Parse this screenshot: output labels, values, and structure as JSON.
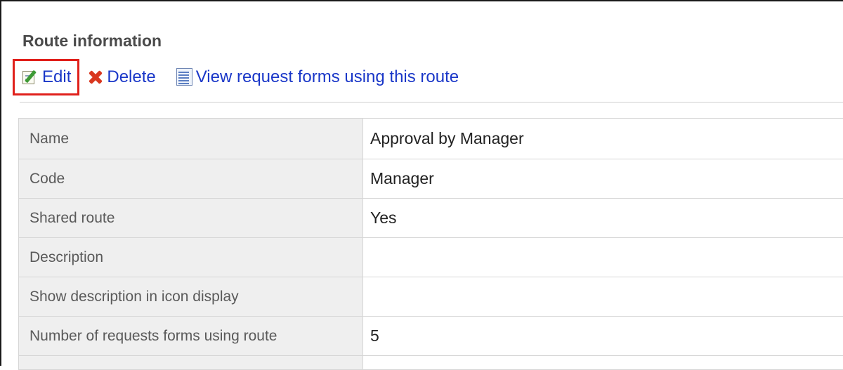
{
  "section": {
    "title": "Route information"
  },
  "actions": {
    "edit_label": "Edit",
    "delete_label": "Delete",
    "view_forms_label": "View request forms using this route",
    "edit_icon": "edit-icon",
    "delete_icon": "delete-icon",
    "view_forms_icon": "list-icon"
  },
  "colors": {
    "link": "#1a37c8",
    "highlight_border": "#e0201b",
    "label_background": "#efefef"
  },
  "details": [
    {
      "label": "Name",
      "value": "Approval by Manager"
    },
    {
      "label": "Code",
      "value": "Manager"
    },
    {
      "label": "Shared route",
      "value": "Yes"
    },
    {
      "label": "Description",
      "value": ""
    },
    {
      "label": "Show description in icon display",
      "value": ""
    },
    {
      "label": "Number of requests forms using route",
      "value": "5"
    }
  ]
}
